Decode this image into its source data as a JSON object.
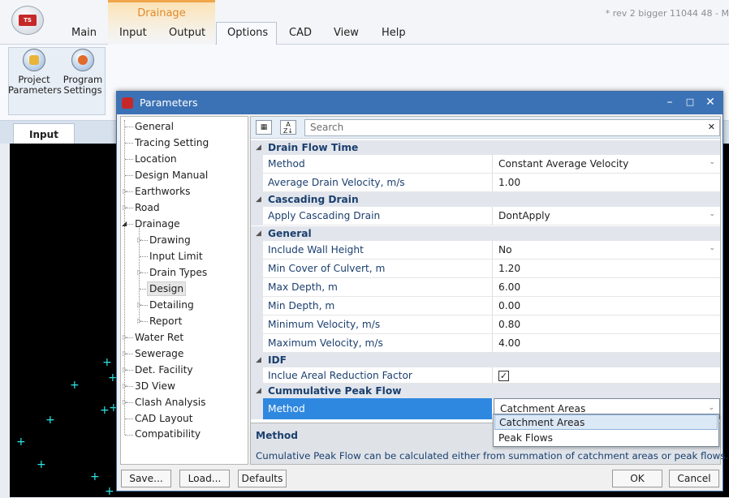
{
  "ribbon": {
    "context_group": "Drainage",
    "title": "* rev 2 bigger  11044 48 - M",
    "tabs": {
      "main": "Main",
      "input": "Input",
      "output": "Output",
      "options": "Options",
      "cad": "CAD",
      "view": "View",
      "help": "Help"
    },
    "buttons": {
      "project": "Project\nParameters",
      "program": "Program\nSettings"
    }
  },
  "document": {
    "tab": "Input"
  },
  "dialog": {
    "title": "Parameters",
    "tree": {
      "general": "General",
      "tracing": "Tracing Setting",
      "location": "Location",
      "design_manual": "Design Manual",
      "earthworks": "Earthworks",
      "road": "Road",
      "drainage": "Drainage",
      "drawing": "Drawing",
      "input_limit": "Input Limit",
      "drain_types": "Drain Types",
      "design": "Design",
      "detailing": "Detailing",
      "report": "Report",
      "water_ret": "Water Ret",
      "sewerage": "Sewerage",
      "det_facility": "Det. Facility",
      "view3d": "3D View",
      "clash": "Clash Analysis",
      "cad_layout": "CAD Layout",
      "compatibility": "Compatibility"
    },
    "grid": {
      "search_placeholder": "Search",
      "cat_drain_flow": "Drain Flow Time",
      "method_name": "Method",
      "method_value": "Constant Average Velocity",
      "avg_vel_name": "Average Drain Velocity, m/s",
      "avg_vel_value": "1.00",
      "cat_cascading": "Cascading Drain",
      "apply_casc_name": "Apply Cascading Drain",
      "apply_casc_value": "DontApply",
      "cat_general": "General",
      "wall_name": "Include Wall Height",
      "wall_value": "No",
      "min_cover_name": "Min Cover of Culvert, m",
      "min_cover_value": "1.20",
      "max_depth_name": "Max Depth, m",
      "max_depth_value": "6.00",
      "min_depth_name": "Min Depth, m",
      "min_depth_value": "0.00",
      "min_vel_name": "Minimum Velocity, m/s",
      "min_vel_value": "0.80",
      "max_vel_name": "Maximum Velocity, m/s",
      "max_vel_value": "4.00",
      "cat_idf": "IDF",
      "areal_name": "Inclue Areal Reduction Factor",
      "areal_value": "✓",
      "cat_cumulative": "Cummulative Peak Flow",
      "cum_method_name": "Method",
      "cum_method_value": "Catchment Areas"
    },
    "dropdown": {
      "opt1": "Catchment Areas",
      "opt2": "Peak Flows"
    },
    "description": {
      "title": "Method",
      "text": "Cumulative Peak Flow can be calculated either from summation of catchment areas or peak flows."
    },
    "buttons": {
      "save": "Save...",
      "load": "Load...",
      "defaults": "Defaults",
      "ok": "OK",
      "cancel": "Cancel"
    }
  }
}
